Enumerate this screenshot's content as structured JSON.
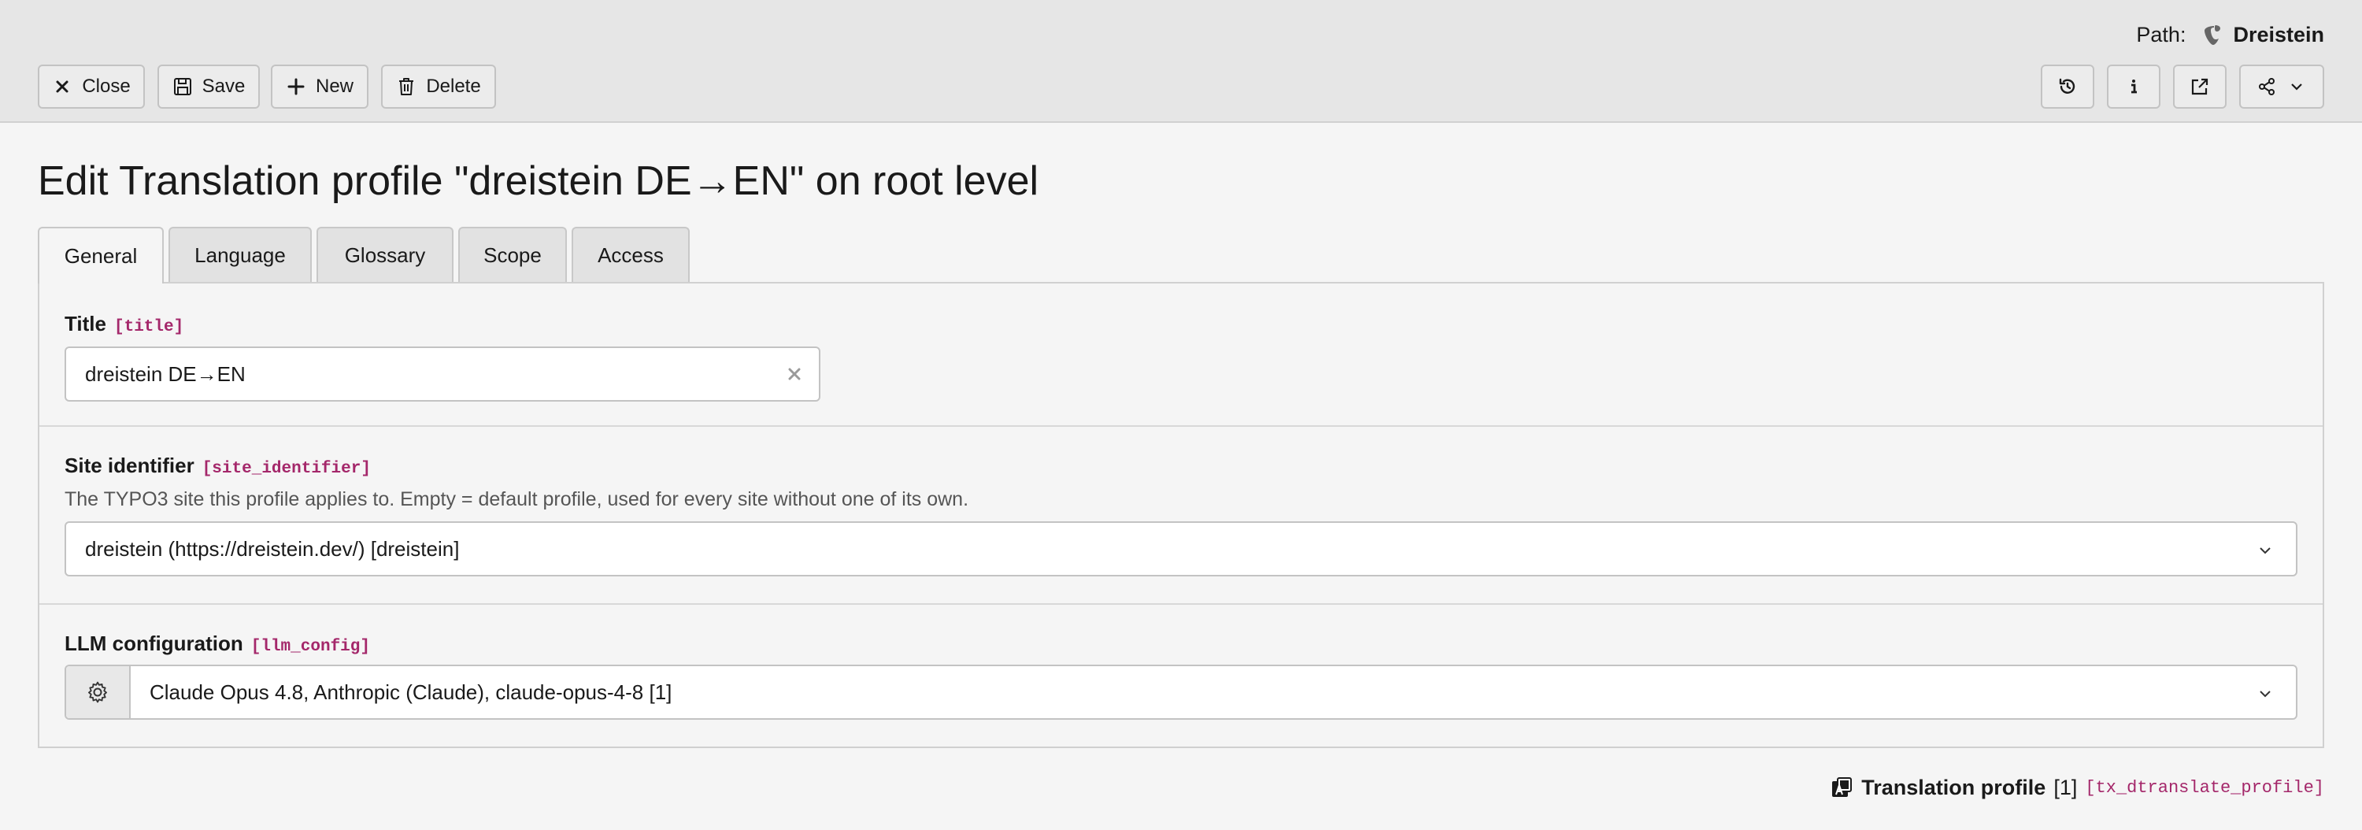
{
  "header": {
    "path_label": "Path:",
    "path_value": "Dreistein",
    "path_icon": "typo3-logo-icon",
    "buttons": {
      "close": "Close",
      "save": "Save",
      "new": "New",
      "delete": "Delete"
    },
    "right_icons": [
      "history-icon",
      "info-icon",
      "external-view-icon",
      "share-icon"
    ]
  },
  "page": {
    "title": "Edit Translation profile \"dreistein DE→EN\" on root level"
  },
  "tabs": [
    {
      "label": "General",
      "active": true
    },
    {
      "label": "Language",
      "active": false
    },
    {
      "label": "Glossary",
      "active": false
    },
    {
      "label": "Scope",
      "active": false
    },
    {
      "label": "Access",
      "active": false
    }
  ],
  "fields": {
    "title": {
      "label": "Title",
      "key": "[title]",
      "value": "dreistein DE→EN"
    },
    "site_identifier": {
      "label": "Site identifier",
      "key": "[site_identifier]",
      "description": "The TYPO3 site this profile applies to. Empty = default profile, used for every site without one of its own.",
      "value": "dreistein (https://dreistein.dev/) [dreistein]"
    },
    "llm_config": {
      "label": "LLM configuration",
      "key": "[llm_config]",
      "value": "Claude Opus 4.8, Anthropic (Claude), claude-opus-4-8 [1]"
    }
  },
  "record": {
    "type": "Translation profile",
    "uid": "[1]",
    "table": "[tx_dtranslate_profile]"
  },
  "colors": {
    "accent_key": "#a4276a",
    "toolbar_bg": "#e6e6e6",
    "page_bg": "#f5f5f5"
  }
}
